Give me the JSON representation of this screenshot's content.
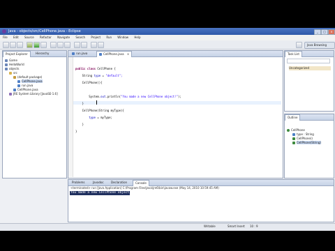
{
  "window": {
    "title": "Java - objects/src/CellPhone.java - Eclipse"
  },
  "menu": [
    "File",
    "Edit",
    "Source",
    "Refactor",
    "Navigate",
    "Search",
    "Project",
    "Run",
    "Window",
    "Help"
  ],
  "perspective": {
    "label": "Java Browsing"
  },
  "package_explorer": {
    "tabs": [
      "Project Explorer",
      "Hierarchy"
    ],
    "items": [
      "Game",
      "HelloWorld",
      "objects",
      "src",
      "(default package)",
      "CellPhone.java",
      "run.java",
      "CellPhone.java",
      "JRE System Library [JavaSE-1.6]"
    ]
  },
  "editor": {
    "tabs": [
      "run.java",
      "CellPhone.java"
    ],
    "lines": [
      {
        "kw": "public class ",
        "rest": "CellPhone {"
      },
      {
        "pre": "    String ",
        "fld": "type",
        "rest": " = ",
        "str": "\"default\";"
      },
      {
        "pre": "    CellPhone(){"
      },
      {
        "pre": ""
      },
      {
        "pre": "        System.",
        "fld": "out",
        "rest": ".println(",
        "str": "\"You made a new CellPhone object!\"",
        "tail": ");"
      },
      {
        "pre": "    }"
      },
      {
        "pre": "    CellPhone(String myType){"
      },
      {
        "pre": "        ",
        "fld": "type",
        "rest": " = myType;"
      },
      {
        "pre": "    }"
      },
      {
        "pre": "}"
      }
    ]
  },
  "task_list": {
    "tab": "Task List",
    "item": "Uncategorized"
  },
  "outline": {
    "tab": "Outline",
    "items": [
      "CellPhone",
      "type : String",
      "CellPhone()",
      "CellPhone(String)"
    ]
  },
  "bottom": {
    "tabs": [
      "Problems",
      "Javadoc",
      "Declaration",
      "Console"
    ],
    "header": "<terminated> run [Java Application] C:\\Program Files\\Java\\jre6\\bin\\javaw.exe (May 14, 2010 10:59:45 AM)",
    "output": "You made a new CellPhone object"
  },
  "status": {
    "writable": "Writable",
    "insert": "Smart Insert",
    "position": "10 : 9"
  }
}
